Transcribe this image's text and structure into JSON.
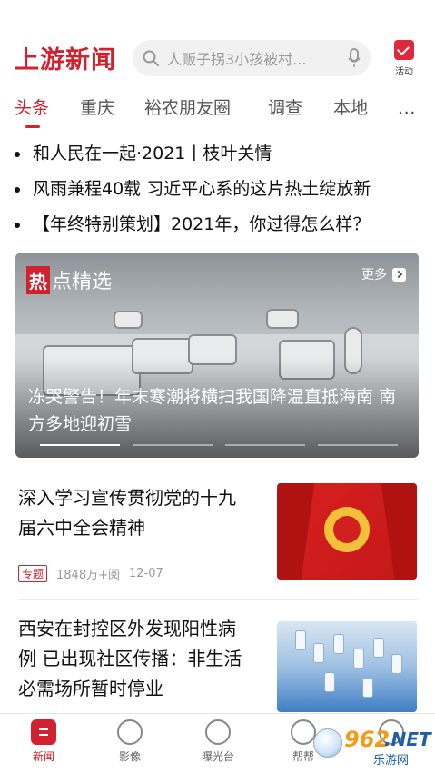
{
  "header": {
    "logo": "上游新闻",
    "search_placeholder": "人贩子拐3小孩被村...",
    "activity_label": "活动"
  },
  "tabs": [
    {
      "label": "头条",
      "active": true
    },
    {
      "label": "重庆"
    },
    {
      "label": "裕农朋友圈"
    },
    {
      "label": "调查"
    },
    {
      "label": "本地"
    }
  ],
  "headlines": [
    "和人民在一起·2021丨枝叶关情",
    "风雨兼程40载 习近平心系的这片热土绽放新",
    "【年终特别策划】2021年，你过得怎么样？"
  ],
  "hero": {
    "tag_hot": "热",
    "tag_rest": "点精选",
    "more_label": "更多",
    "title": "冻哭警告！年末寒潮将横扫我国降温直抵海南 南方多地迎初雪",
    "dots": 4,
    "active_dot": 0
  },
  "cards": [
    {
      "title": "深入学习宣传贯彻党的十九届六中全会精神",
      "tag": "专题",
      "views": "1848万+阅",
      "date": "12-07"
    },
    {
      "title": "西安在封控区外发现阳性病例 已出现社区传播：非生活必需场所暂时停业"
    }
  ],
  "bottom_nav": [
    {
      "label": "新闻",
      "active": true
    },
    {
      "label": "影像"
    },
    {
      "label": "曝光台"
    },
    {
      "label": "帮帮"
    },
    {
      "label": ""
    }
  ],
  "watermark": {
    "number": "962",
    "domain": ".NET",
    "subtitle": "乐游网"
  },
  "colors": {
    "brand": "#d2212e"
  }
}
